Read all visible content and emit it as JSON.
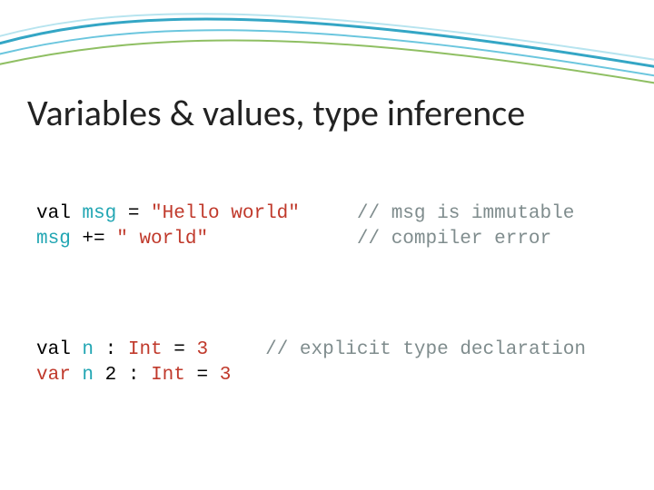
{
  "title": "Variables & values, type inference",
  "code": {
    "l1": {
      "kw": "val ",
      "id": "msg",
      "mid": " = ",
      "lit": "\"Hello world\"",
      "sp": "     ",
      "cmt": "// msg is immutable"
    },
    "l2": {
      "id": "msg",
      "mid": " += ",
      "lit": "\" world\"",
      "sp": "             ",
      "cmt": "// compiler error"
    },
    "l3": {
      "kw": "val ",
      "id": "n",
      "mid1": " : ",
      "type": "Int",
      "mid2": " = ",
      "lit": "3",
      "sp": "     ",
      "cmt": "// explicit type declaration"
    },
    "l4": {
      "kw": "var ",
      "id": "n",
      "n2": " 2",
      "mid1": " : ",
      "type": "Int",
      "mid2": " = ",
      "lit": "3"
    }
  }
}
